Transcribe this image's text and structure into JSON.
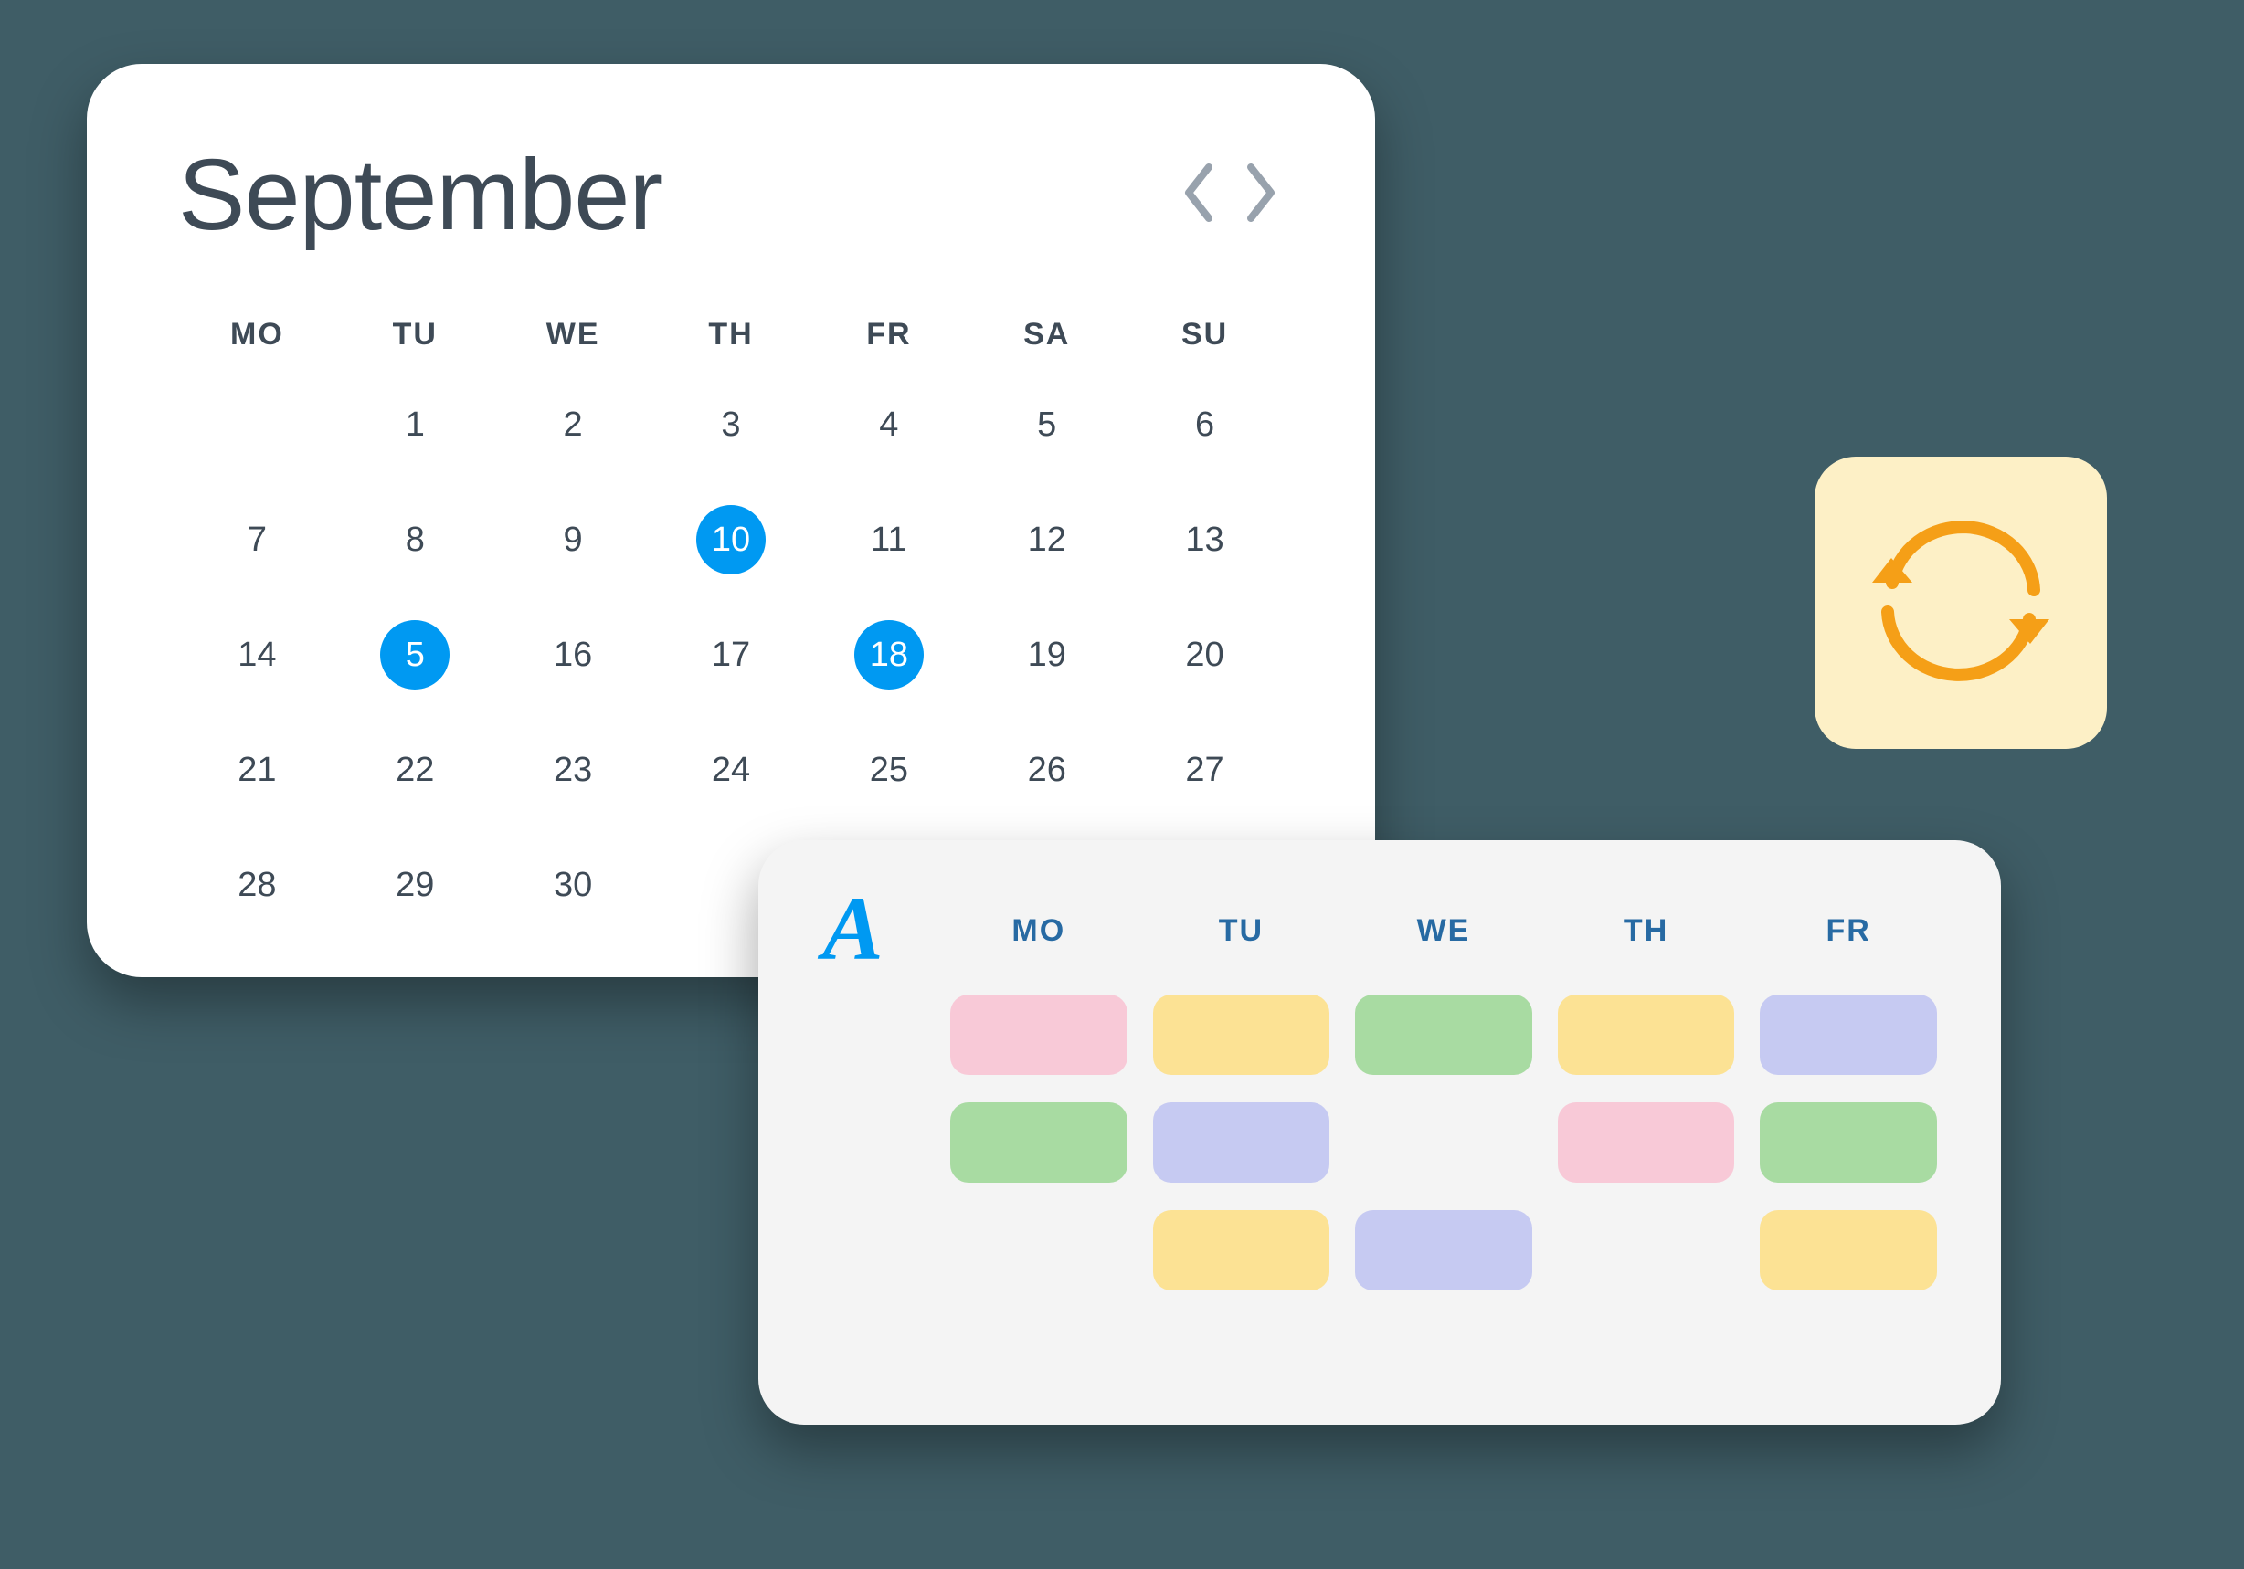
{
  "calendar": {
    "month": "September",
    "days_of_week": [
      "MO",
      "TU",
      "WE",
      "TH",
      "FR",
      "SA",
      "SU"
    ],
    "dates": [
      [
        "",
        "1",
        "2",
        "3",
        "4",
        "5",
        "6"
      ],
      [
        "7",
        "8",
        "9",
        "10",
        "11",
        "12",
        "13"
      ],
      [
        "14",
        "5",
        "16",
        "17",
        "18",
        "19",
        "20"
      ],
      [
        "21",
        "22",
        "23",
        "24",
        "25",
        "26",
        "27"
      ],
      [
        "28",
        "29",
        "30",
        "",
        "",
        "",
        ""
      ]
    ],
    "selected": [
      "10",
      "5",
      "18"
    ]
  },
  "schedule": {
    "logo": "A",
    "days_of_week": [
      "MO",
      "TU",
      "WE",
      "TH",
      "FR"
    ],
    "blocks": [
      [
        "pink",
        "yellow",
        "green",
        "yellow",
        "purple"
      ],
      [
        "green",
        "purple",
        "none",
        "pink",
        "green"
      ],
      [
        "none",
        "yellow",
        "purple",
        "none",
        "yellow"
      ]
    ]
  },
  "sync_icon_color": "#f59f17"
}
